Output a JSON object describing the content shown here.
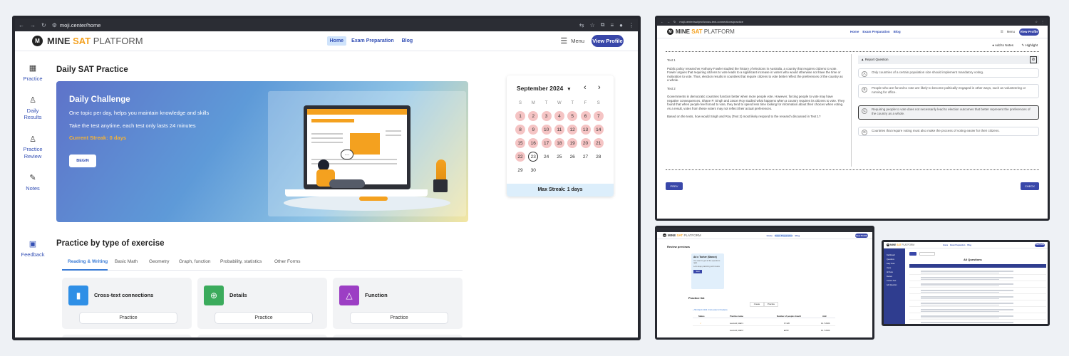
{
  "main": {
    "tab_url": "moji.center/home",
    "brand": {
      "logo_mark": "M",
      "mine": "MINE",
      "sat": "SAT",
      "platform": "PLATFORM"
    },
    "nav": [
      "Home",
      "Exam Preparation",
      "Blog"
    ],
    "menu_label": "Menu",
    "view_profile": "View Profile",
    "sidebar": [
      {
        "label": "Practice",
        "icon": "grid-icon"
      },
      {
        "label": "Daily Results",
        "icon": "person-icon"
      },
      {
        "label": "Practice Review",
        "icon": "person-icon"
      },
      {
        "label": "Notes",
        "icon": "notes-icon"
      },
      {
        "label": "Feedback",
        "icon": "feedback-icon"
      }
    ],
    "page_title": "Daily SAT Practice",
    "challenge": {
      "title": "Daily Challenge",
      "line1": "One topic per day, helps you maintain knowledge and skills",
      "line2": "Take the test anytime, each test only lasts 24 minutes",
      "streak": "Current Streak: 0 days",
      "begin": "BEGIN"
    },
    "calendar": {
      "month": "September 2024",
      "weekdays": [
        "S",
        "M",
        "T",
        "W",
        "T",
        "F",
        "S"
      ],
      "rows": [
        [
          "1",
          "2",
          "3",
          "4",
          "5",
          "6",
          "7"
        ],
        [
          "8",
          "9",
          "10",
          "11",
          "12",
          "13",
          "14"
        ],
        [
          "15",
          "16",
          "17",
          "18",
          "19",
          "20",
          "21"
        ],
        [
          "22",
          "23",
          "24",
          "25",
          "26",
          "27",
          "28"
        ],
        [
          "29",
          "30"
        ]
      ],
      "max_streak": "Max Streak: 1 days"
    },
    "practice_title": "Practice by type of exercise",
    "tabs": [
      "Reading & Writing",
      "Basic Math",
      "Geometry",
      "Graph, function",
      "Probability, statistics",
      "Other Forms"
    ],
    "cards": [
      {
        "name": "Cross-text connections",
        "btn": "Practice",
        "color": "#2f8fe6"
      },
      {
        "name": "Details",
        "btn": "Practice",
        "color": "#3bab5c"
      },
      {
        "name": "Function",
        "btn": "Practice",
        "color": "#9c3ec4"
      }
    ],
    "card_row2_colors": [
      "#e0463f",
      "#3d5ac2",
      "#e04b86"
    ]
  },
  "question": {
    "tab_url": "moji.center/subject/cross-text-connections/practice",
    "nav": [
      "Home",
      "Exam Preparation",
      "Blog"
    ],
    "menu_label": "Menu",
    "view_profile": "View Profile",
    "add_notes": "Add to Notes",
    "highlight": "Highlight",
    "text1_label": "Text 1",
    "text1": "Public policy researcher Anthony Fowler studied the history of elections in Australia, a country that requires citizens to vote. Fowler argues that requiring citizens to vote leads to a significant increase in voters who would otherwise not have the time or motivation to vote. Thus, election results in countries that require citizens to vote better reflect the preferences of the country as a whole.",
    "text2_label": "Text 2",
    "text2": "Governments in democratic countries function better when more people vote. However, forcing people to vote may have negative consequences. Shane P. Singh and Jason Roy studied what happens when a country requires its citizens to vote. They found that when people feel forced to vote, they tend to spend less time looking for information about their choices when voting. As a result, votes from these voters may not reflect their actual preferences.",
    "prompt": "Based on the texts, how would Singh and Roy (Text 2) most likely respond to the research discussed in Text 1?",
    "report": "Report Question",
    "answers": [
      {
        "letter": "A",
        "text": "Only countries of a certain population size should implement mandatory voting."
      },
      {
        "letter": "B",
        "text": "People who are forced to vote are likely to become politically engaged in other ways, such as volunteering or running for office."
      },
      {
        "letter": "C",
        "text": "Requiring people to vote does not necessarily lead to election outcomes that better represent the preferences of the country as a whole."
      },
      {
        "letter": "D",
        "text": "Countries that require voting must also make the process of voting easier for their citizens."
      }
    ],
    "prev": "PREV",
    "check": "CHECK"
  },
  "review": {
    "title": "Review previews",
    "card_title": "Ad o Tacher (Stance)",
    "card_lines": [
      "You want to get all the questions right",
      "Let's keep practicing and review"
    ],
    "card_btn": "Start",
    "practice_title": "Practice list",
    "toggle": [
      "Create",
      "Practice"
    ],
    "link": "+ 5th March 2024 / Full-mode for Students",
    "headers": [
      "Status",
      "Practice name",
      "Number of people should",
      "Add"
    ],
    "rows": [
      [
        "✓",
        "Leonard, Hall 1",
        "★ 120",
        "12.7.2024"
      ],
      [
        "",
        "Leonard, Hall 2",
        "♟ 60",
        "12.7.2024"
      ]
    ]
  },
  "admin": {
    "title": "All Questions",
    "menu": [
      "Dashboard",
      "Questions",
      "Daily Tests",
      "Users",
      "All Tests",
      "Review",
      "Custom Test",
      "Add Question"
    ]
  }
}
